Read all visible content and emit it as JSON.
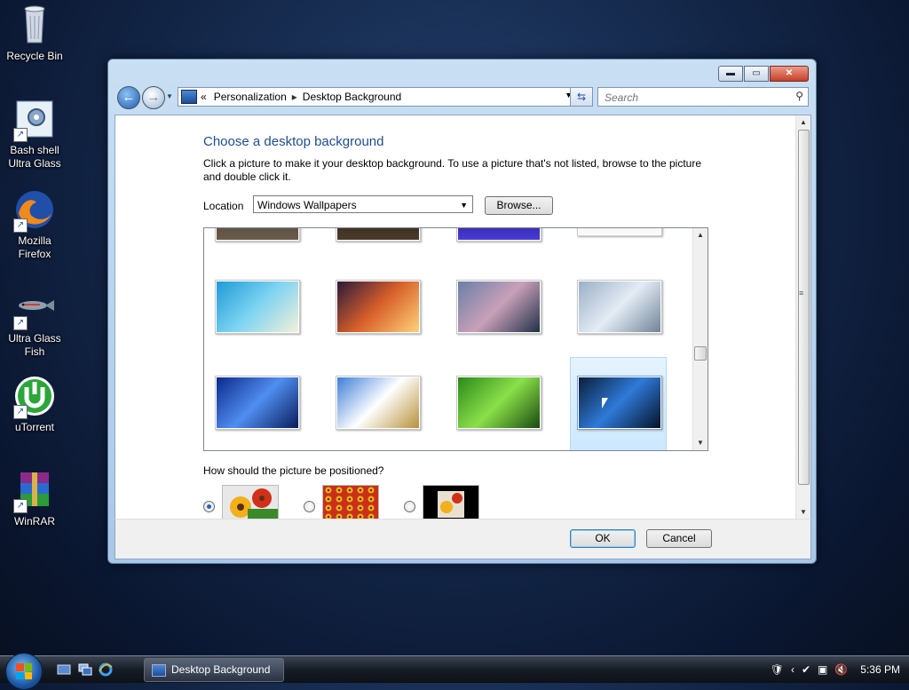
{
  "desktop": {
    "icons": [
      {
        "label": "Recycle Bin"
      },
      {
        "label": "Bash shell Ultra Glass"
      },
      {
        "label": "Mozilla Firefox"
      },
      {
        "label": "Ultra Glass Fish"
      },
      {
        "label": "uTorrent"
      },
      {
        "label": "WinRAR"
      }
    ]
  },
  "window": {
    "controls": {
      "minimize": "▬",
      "maximize": "▭",
      "close": "✕"
    },
    "address": {
      "prefix": "«",
      "crumbs": [
        "Personalization",
        "Desktop Background"
      ],
      "separator": "▸"
    },
    "search": {
      "placeholder": "Search",
      "icon": "search-icon"
    },
    "heading": "Choose a desktop background",
    "description": "Click a picture to make it your desktop background. To use a picture that's not listed, browse to the picture and double click it.",
    "location": {
      "label": "Location",
      "value": "Windows Wallpapers",
      "browse": "Browse..."
    },
    "gallery": {
      "rows": [
        [
          {
            "name": "tropical-beach",
            "colors": [
              "#1e9bd6",
              "#7ed4f2",
              "#f4f0d8"
            ]
          },
          {
            "name": "grass-sunset",
            "colors": [
              "#2a1a3a",
              "#d8602a",
              "#ffd27a"
            ]
          },
          {
            "name": "mountain-valley",
            "colors": [
              "#6a7fa8",
              "#c9a0b8",
              "#203048"
            ]
          },
          {
            "name": "glass-reflection",
            "colors": [
              "#9ab0c8",
              "#e4ecf4",
              "#6f8499"
            ]
          }
        ],
        [
          {
            "name": "blue-swoosh",
            "colors": [
              "#0c2a8a",
              "#4f8ef0",
              "#0a1c5c"
            ]
          },
          {
            "name": "wheat-field",
            "colors": [
              "#3d7ed8",
              "#ffffff",
              "#b8913a"
            ]
          },
          {
            "name": "green-leaf",
            "colors": [
              "#2a8a1a",
              "#8be04a",
              "#1a4a10"
            ]
          },
          {
            "name": "windows-10",
            "colors": [
              "#0a1e3a",
              "#2f7ad8",
              "#061226"
            ]
          }
        ]
      ],
      "selected_index": 7
    },
    "position": {
      "label": "How should the picture be positioned?",
      "options": [
        "fill",
        "tile",
        "center"
      ],
      "selected": 0
    },
    "buttons": {
      "ok": "OK",
      "cancel": "Cancel"
    }
  },
  "taskbar": {
    "task": "Desktop Background",
    "clock": "5:36 PM"
  }
}
